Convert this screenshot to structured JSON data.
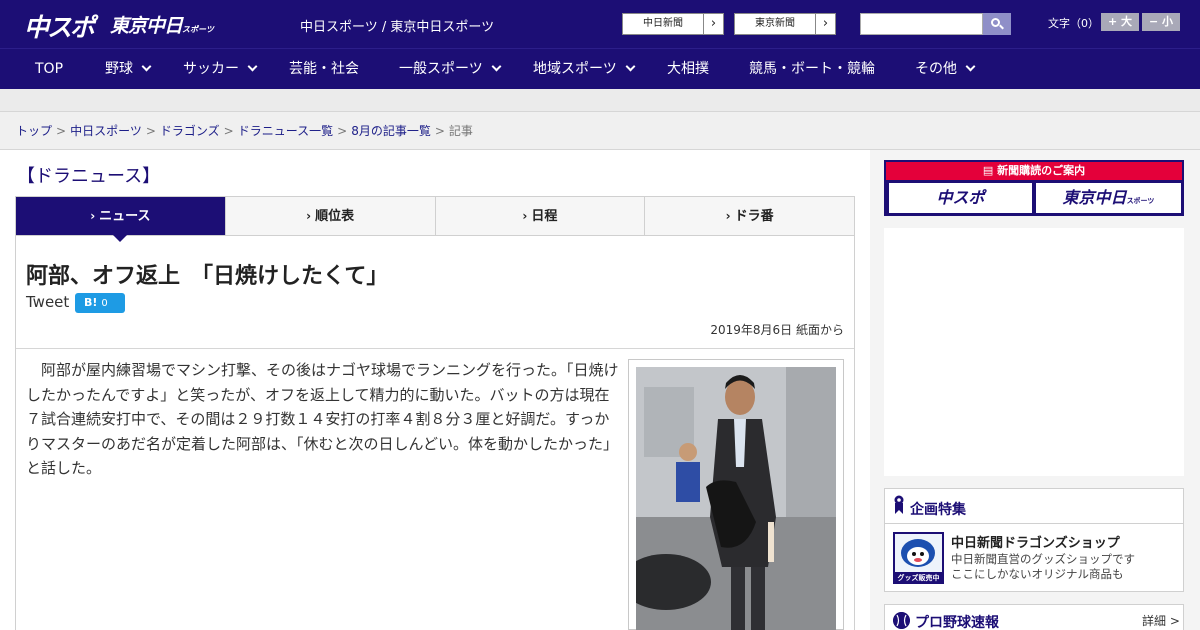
{
  "header": {
    "logo_chunichi_sports": "中スポ",
    "logo_tokyo_chunichi": "東京中日",
    "logo_tokyo_chunichi_sub": "スポーツ",
    "site_name": "中日スポーツ / 東京中日スポーツ",
    "paper_links": [
      "中日新聞",
      "東京新聞"
    ],
    "search_placeholder": "",
    "font_size_label": "文字（0）",
    "font_increase": "+ 大",
    "font_decrease": "− 小"
  },
  "nav": {
    "items": [
      {
        "label": "TOP",
        "has_menu": false
      },
      {
        "label": "野球",
        "has_menu": true
      },
      {
        "label": "サッカー",
        "has_menu": true
      },
      {
        "label": "芸能・社会",
        "has_menu": false
      },
      {
        "label": "一般スポーツ",
        "has_menu": true
      },
      {
        "label": "地域スポーツ",
        "has_menu": true
      },
      {
        "label": "大相撲",
        "has_menu": false
      },
      {
        "label": "競馬・ボート・競輪",
        "has_menu": false
      },
      {
        "label": "その他",
        "has_menu": true
      }
    ]
  },
  "breadcrumb": {
    "items": [
      "トップ",
      "中日スポーツ",
      "ドラゴンズ",
      "ドラニュース一覧",
      "8月の記事一覧"
    ],
    "current": "記事",
    "separator": ">"
  },
  "section": {
    "heading": "【ドラニュース】",
    "tabs": [
      {
        "label": "ニュース",
        "active": true
      },
      {
        "label": "順位表",
        "active": false
      },
      {
        "label": "日程",
        "active": false
      },
      {
        "label": "ドラ番",
        "active": false
      }
    ],
    "tab_bullet": "›"
  },
  "article": {
    "headline": "阿部、オフ返上　「日焼けしたくて」",
    "tweet_label": "Tweet",
    "hatena_label": "B!",
    "hatena_count": "0",
    "dateline": "2019年8月6日 紙面から",
    "body": "阿部が屋内練習場でマシン打撃、その後はナゴヤ球場でランニングを行った。「日焼けしたかったんですよ」と笑ったが、オフを返上して精力的に動いた。バットの方は現在７試合連続安打中で、その間は２９打数１４安打の打率４割８分３厘と好調だ。すっかりマスターのあだ名が定着した阿部は、「休むと次の日しんどい。体を動かしたかった」と話した。"
  },
  "sidebar": {
    "subscribe_banner": "新聞購読のご案内",
    "subscribe_chunichi": "中スポ",
    "subscribe_tokyo": "東京中日",
    "subscribe_tokyo_sub": "スポーツ",
    "feature_title": "企画特集",
    "shop_thumb_label": "グッズ販売中",
    "shop_title": "中日新聞ドラゴンズショップ",
    "shop_desc_line1": "中日新聞直営のグッズショップです",
    "shop_desc_line2": "ここにしかないオリジナル商品も",
    "score_title": "プロ野球速報",
    "score_more": "詳細 >"
  },
  "colors": {
    "brand_navy": "#1c0e75",
    "subscribe_red": "#e4003a",
    "hatena_blue": "#1e9be4"
  }
}
